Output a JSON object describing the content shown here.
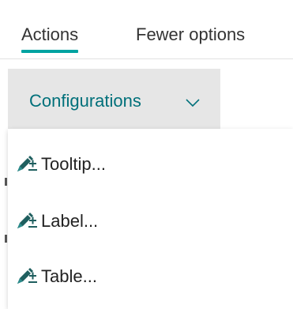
{
  "tabs": {
    "active_label": "Actions",
    "secondary_label": "Fewer options"
  },
  "configurations": {
    "label": "Configurations",
    "chevron_icon": "chevron-down-icon"
  },
  "menu": {
    "items": [
      {
        "label": "Tooltip...",
        "icon": "edit-add-icon"
      },
      {
        "label": "Label...",
        "icon": "edit-add-icon"
      },
      {
        "label": "Table...",
        "icon": "edit-add-icon"
      }
    ]
  },
  "colors": {
    "accent": "#00a3a1",
    "accent_text": "#00707a",
    "button_bg": "#e6e6e6"
  }
}
